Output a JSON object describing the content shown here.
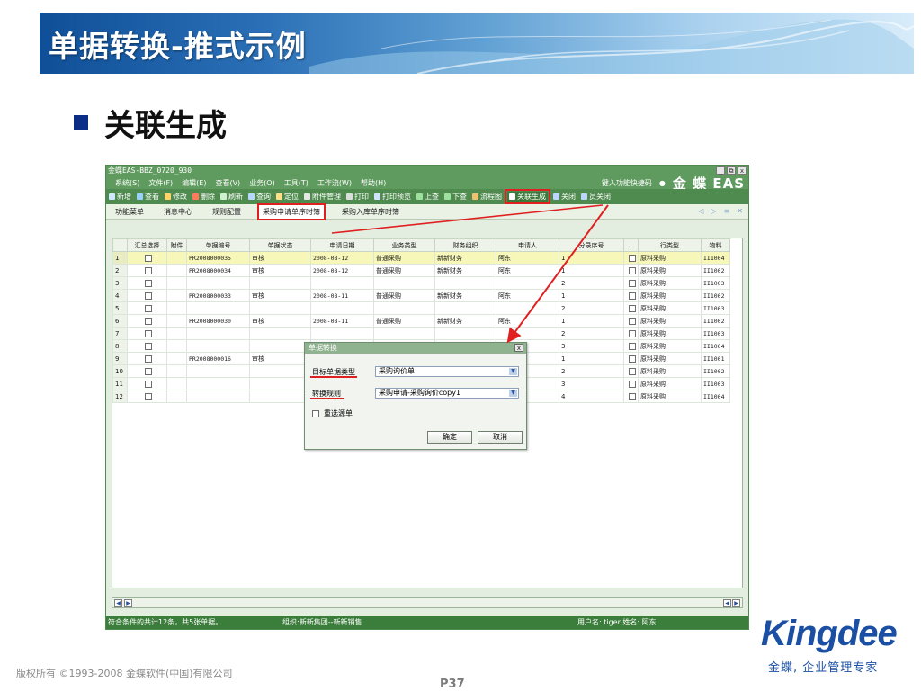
{
  "slide": {
    "title": "单据转换-推式示例",
    "subtitle": "关联生成",
    "copyright": "版权所有 ©1993-2008 金蝶软件(中国)有限公司",
    "page": "P37",
    "logo": "Kingdee",
    "tagline": "金蝶, 企业管理专家"
  },
  "window": {
    "title": "金蝶EAS-BBZ_0720_930",
    "controls": [
      "_",
      "⧉",
      "x"
    ],
    "menus": [
      "系统(S)",
      "文件(F)",
      "编辑(E)",
      "查看(V)",
      "业务(O)",
      "工具(T)",
      "工作流(W)",
      "帮助(H)"
    ],
    "shortcut_label": "键入功能快捷码",
    "brand": "金 蝶 EAS"
  },
  "toolbar": {
    "items": [
      "新增",
      "查看",
      "修改",
      "删除",
      "刷新",
      "查询",
      "定位",
      "附件管理",
      "打印",
      "打印预览",
      "上查",
      "下查",
      "流程图",
      "关联生成",
      "关闭",
      "员关闭"
    ],
    "highlight": "关联生成"
  },
  "tabs": {
    "items": [
      "功能菜单",
      "消息中心",
      "规则配置",
      "采购申请单序时簿",
      "采购入库单序时簿"
    ],
    "active": "采购申请单序时簿",
    "nav": [
      "◁",
      "▷",
      "≡",
      "✕"
    ]
  },
  "grid": {
    "columns": [
      "",
      "汇总选择",
      "附件",
      "单据编号",
      "单据状态",
      "申请日期",
      "业务类型",
      "财务组织",
      "申请人",
      "分录序号",
      "...",
      "行类型",
      "物料"
    ],
    "rows": [
      {
        "n": "1",
        "no": "PR2008000035",
        "status": "审核",
        "date": "2008-08-12",
        "biz": "普通采购",
        "org": "新新财务",
        "person": "阿东",
        "seq": "1",
        "rowtype": "原料采购",
        "mat": "II1004"
      },
      {
        "n": "2",
        "no": "PR2008000034",
        "status": "审核",
        "date": "2008-08-12",
        "biz": "普通采购",
        "org": "新新财务",
        "person": "阿东",
        "seq": "1",
        "rowtype": "原料采购",
        "mat": "II1002"
      },
      {
        "n": "3",
        "no": "",
        "status": "",
        "date": "",
        "biz": "",
        "org": "",
        "person": "",
        "seq": "2",
        "rowtype": "原料采购",
        "mat": "II1003"
      },
      {
        "n": "4",
        "no": "PR2008000033",
        "status": "审核",
        "date": "2008-08-11",
        "biz": "普通采购",
        "org": "新新财务",
        "person": "阿东",
        "seq": "1",
        "rowtype": "原料采购",
        "mat": "II1002"
      },
      {
        "n": "5",
        "no": "",
        "status": "",
        "date": "",
        "biz": "",
        "org": "",
        "person": "",
        "seq": "2",
        "rowtype": "原料采购",
        "mat": "II1003"
      },
      {
        "n": "6",
        "no": "PR2008000030",
        "status": "审核",
        "date": "2008-08-11",
        "biz": "普通采购",
        "org": "新新财务",
        "person": "阿东",
        "seq": "1",
        "rowtype": "原料采购",
        "mat": "II1002"
      },
      {
        "n": "7",
        "no": "",
        "status": "",
        "date": "",
        "biz": "",
        "org": "",
        "person": "",
        "seq": "2",
        "rowtype": "原料采购",
        "mat": "II1003"
      },
      {
        "n": "8",
        "no": "",
        "status": "",
        "date": "",
        "biz": "",
        "org": "",
        "person": "",
        "seq": "3",
        "rowtype": "原料采购",
        "mat": "II1004"
      },
      {
        "n": "9",
        "no": "PR2008000016",
        "status": "审核",
        "date": "",
        "biz": "",
        "org": "",
        "person": "",
        "seq": "1",
        "rowtype": "原料采购",
        "mat": "II1001"
      },
      {
        "n": "10",
        "no": "",
        "status": "",
        "date": "",
        "biz": "",
        "org": "",
        "person": "",
        "seq": "2",
        "rowtype": "原料采购",
        "mat": "II1002"
      },
      {
        "n": "11",
        "no": "",
        "status": "",
        "date": "",
        "biz": "",
        "org": "",
        "person": "",
        "seq": "3",
        "rowtype": "原料采购",
        "mat": "II1003"
      },
      {
        "n": "12",
        "no": "",
        "status": "",
        "date": "",
        "biz": "",
        "org": "",
        "person": "",
        "seq": "4",
        "rowtype": "原料采购",
        "mat": "II1004"
      }
    ]
  },
  "dialog": {
    "title": "单据转换",
    "target_label": "目标单据类型",
    "target_value": "采购询价单",
    "rule_label": "转换规则",
    "rule_value": "采购申请-采购询价copy1",
    "reselect_label": "重选源单",
    "ok": "确定",
    "cancel": "取消",
    "close": "x"
  },
  "status": {
    "left": "符合条件的共计12条，共5张单据。",
    "org": "组织:新新集团--新新销售",
    "user": "用户名: tiger 姓名: 阿东"
  },
  "colors": {
    "window_green": "#4f8b4f",
    "highlight_red": "#e02020",
    "selected_row": "#f6f7b8",
    "brand_blue": "#1a4fa3"
  }
}
